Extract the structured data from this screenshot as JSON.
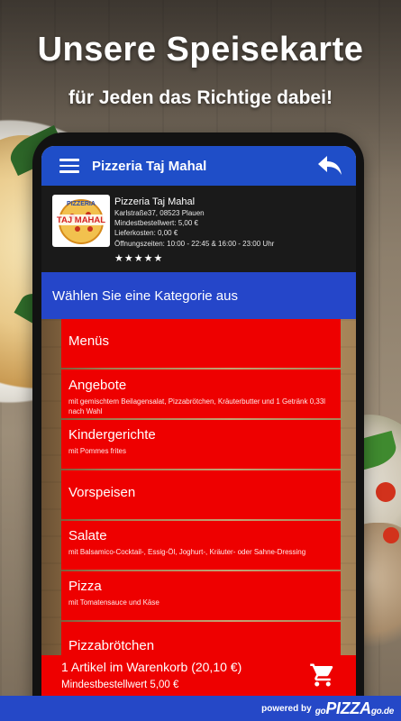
{
  "promo": {
    "headline": "Unsere Speisekarte",
    "subline": "für Jeden das Richtige dabei!"
  },
  "appbar": {
    "title": "Pizzeria Taj Mahal",
    "menu_icon": "hamburger-menu-icon",
    "back_icon": "back-arrow-icon"
  },
  "restaurant": {
    "logo_text_top": "PIZZERIA",
    "logo_text_main": "TAJ MAHAL",
    "name": "Pizzeria Taj Mahal",
    "address": "Karlstraße37, 08523 Plauen",
    "min_order": "Mindestbestellwert: 5,00 €",
    "delivery_cost": "Lieferkosten: 0,00 €",
    "opening_hours": "Öffnungszeiten: 10:00 - 22:45 & 16:00 - 23:00 Uhr",
    "rating_stars": 5
  },
  "category_prompt": "Wählen Sie eine Kategorie aus",
  "categories": [
    {
      "title": "Menüs",
      "desc": ""
    },
    {
      "title": "Angebote",
      "desc": "mit gemischtem Beilagensalat, Pizzabrötchen, Kräuterbutter und 1 Getränk 0,33l nach Wahl"
    },
    {
      "title": "Kindergerichte",
      "desc": "mit Pommes frites"
    },
    {
      "title": "Vorspeisen",
      "desc": ""
    },
    {
      "title": "Salate",
      "desc": "mit Balsamico-Cocktail-, Essig-Öl, Joghurt-, Kräuter- oder Sahne-Dressing"
    },
    {
      "title": "Pizza",
      "desc": "mit Tomatensauce und Käse"
    },
    {
      "title": "Pizzabrötchen",
      "desc": ""
    }
  ],
  "cart": {
    "summary": "1 Artikel im Warenkorb (20,10 €)",
    "min_order": "Mindestbestellwert 5,00 €",
    "icon": "shopping-cart-icon"
  },
  "footer": {
    "powered_by": "powered by",
    "brand_go1": "go",
    "brand_pizza": "PIZZA",
    "brand_go2": "go",
    "brand_tld": ".de"
  },
  "colors": {
    "appbar_blue": "#1f4ec8",
    "category_blue": "#2546c9",
    "item_red": "#ee0000",
    "footer_blue": "#2548c7"
  }
}
